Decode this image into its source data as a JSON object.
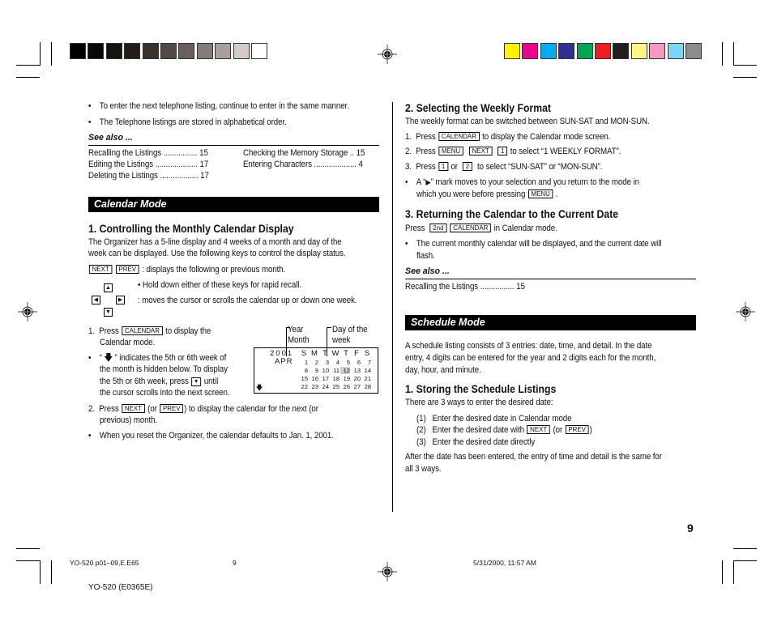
{
  "color_bars": {
    "grayscale": [
      "#000000",
      "#0a0807",
      "#151210",
      "#221d1b",
      "#3a312e",
      "#524844",
      "#6a5f5b",
      "#857a76",
      "#a99f9b",
      "#d3cbc8",
      "#ffffff"
    ],
    "process": [
      "#fff200",
      "#ec008c",
      "#00aeef",
      "#2e3192",
      "#00a651",
      "#ed1c24",
      "#231f20",
      "#fff685",
      "#f49ac1",
      "#7dd5f6",
      "#8c8c8c"
    ]
  },
  "left_column": {
    "bullets_top": [
      "To enter the next telephone listing, continue to enter in the same manner.",
      "The Telephone listings are stored in alphabetical order."
    ],
    "see_also_label": "See also ...",
    "see_also_left": [
      {
        "title": "Recalling the Listings ................",
        "page": "15"
      },
      {
        "title": "Editing the Listings ....................",
        "page": "17"
      },
      {
        "title": "Deleting the Listings ..................",
        "page": "17"
      }
    ],
    "see_also_right": [
      {
        "title": "Checking the Memory Storage ..",
        "page": "15"
      },
      {
        "title": "Entering Characters ....................",
        "page": "4"
      }
    ],
    "calendar_mode_bar": "Calendar Mode",
    "section1_heading": "1. Controlling the Monthly Calendar Display",
    "section1_intro_line1": "The Organizer has a 5-line display and 4 weeks of a month and day of the",
    "section1_intro_line2": "week can be displayed. Use the following keys to control the display status.",
    "keys_next": "NEXT",
    "keys_prev": "PREV",
    "next_prev_desc": ": displays the following or previous month.",
    "hold_down_desc": "• Hold down either of these keys for rapid recall.",
    "arrow_desc": ":  moves the cursor or scrolls the calendar up or down one week.",
    "step1_num": "1.",
    "step1_press": "Press",
    "step1_key": "CALENDAR",
    "step1_rest": "to display the",
    "step1_line2": "Calendar mode.",
    "hidden_week_line1a": "“",
    "hidden_week_line1b": "” indicates the 5th or 6th week of",
    "hidden_week_line2": "the month is hidden below. To display",
    "hidden_week_line3a": "the 5th or 6th week, press",
    "hidden_week_line3b": "until",
    "hidden_week_line4": "the cursor scrolls into the next screen.",
    "step2_num": "2.",
    "step2_press": "Press",
    "step2_key1": "NEXT",
    "step2_or": "(or",
    "step2_key2": "PREV",
    "step2_rest": ") to display the calendar for the next (or",
    "step2_line2": "previous) month.",
    "reset_note": "When you reset the Organizer, the calendar defaults to Jan. 1, 2001."
  },
  "calendar_display": {
    "label_year": "Year",
    "label_month": "Month",
    "label_dow1": "Day of the",
    "label_dow2": "week",
    "year": "2001",
    "month": "APR",
    "weekdays": [
      "S",
      "M",
      "T",
      "W",
      "T",
      "F",
      "S"
    ],
    "weeks": [
      [
        "1",
        "2",
        "3",
        "4",
        "5",
        "6",
        "7"
      ],
      [
        "8",
        "9",
        "10",
        "11",
        "12",
        "13",
        "14"
      ],
      [
        "15",
        "16",
        "17",
        "18",
        "19",
        "20",
        "21"
      ],
      [
        "22",
        "23",
        "24",
        "25",
        "26",
        "27",
        "28"
      ]
    ],
    "highlighted_day": "12",
    "more_below_icon": "down-arrow-icon"
  },
  "right_column": {
    "section2_heading": "2. Selecting the Weekly Format",
    "section2_intro": "The weekly format can be switched between SUN-SAT and MON-SUN.",
    "s2_step1_num": "1.",
    "s2_step1_press": "Press",
    "s2_step1_key": "CALENDAR",
    "s2_step1_rest": "to display the Calendar mode screen.",
    "s2_step2_num": "2.",
    "s2_step2_press": "Press",
    "s2_step2_key1": "MENU",
    "s2_step2_key2": "NEXT",
    "s2_step2_key3": "1",
    "s2_step2_rest": "to select “1 WEEKLY FORMAT”.",
    "s2_step3_num": "3.",
    "s2_step3_press": "Press",
    "s2_step3_key1": "1",
    "s2_step3_or": "or",
    "s2_step3_key2": "2",
    "s2_step3_rest": "to select “SUN-SAT” or “MON-SUN”.",
    "s2_bullet_a": "A “",
    "s2_bullet_b": "” mark moves to your selection and you return to the mode in",
    "s2_bullet_line2": "which you were before pressing",
    "s2_bullet_key": "MENU",
    "s2_bullet_end": ".",
    "section3_heading": "3. Returning the Calendar to the Current Date",
    "s3_press": "Press",
    "s3_key1": "2nd",
    "s3_key2": "CALENDAR",
    "s3_rest": "in Calendar mode.",
    "s3_bullet_line1": "The current monthly calendar will be displayed, and the current date will",
    "s3_bullet_line2": "flash.",
    "see_also_label": "See also ...",
    "see_also_items": [
      {
        "title": "Recalling the Listings ................",
        "page": "15"
      }
    ],
    "schedule_mode_bar": "Schedule Mode",
    "schedule_intro_line1": "A schedule listing consists of 3 entries: date, time, and detail. In the date",
    "schedule_intro_line2": "entry, 4 digits can be entered for the year and 2 digits each for the month,",
    "schedule_intro_line3": "day, hour, and minute.",
    "storing_heading": "1. Storing the Schedule Listings",
    "storing_intro": "There are 3 ways to enter the desired date:",
    "way1_num": "(1)",
    "way1_text": "Enter the desired date in Calendar mode",
    "way2_num": "(2)",
    "way2_text": "Enter the desired date with",
    "way2_key1": "NEXT",
    "way2_or": "(or",
    "way2_key2": "PREV",
    "way2_end": ")",
    "way3_num": "(3)",
    "way3_text": "Enter the desired date directly",
    "after_line1": "After the date has been entered, the entry of time and detail is the same for",
    "after_line2": "all 3 ways."
  },
  "page_number": "9",
  "footer": {
    "file_info": "YO-520 p01–09,E.E65",
    "page": "9",
    "datetime": "5/31/2000, 11:57 AM",
    "model": "YO-520 (E0365E)"
  }
}
